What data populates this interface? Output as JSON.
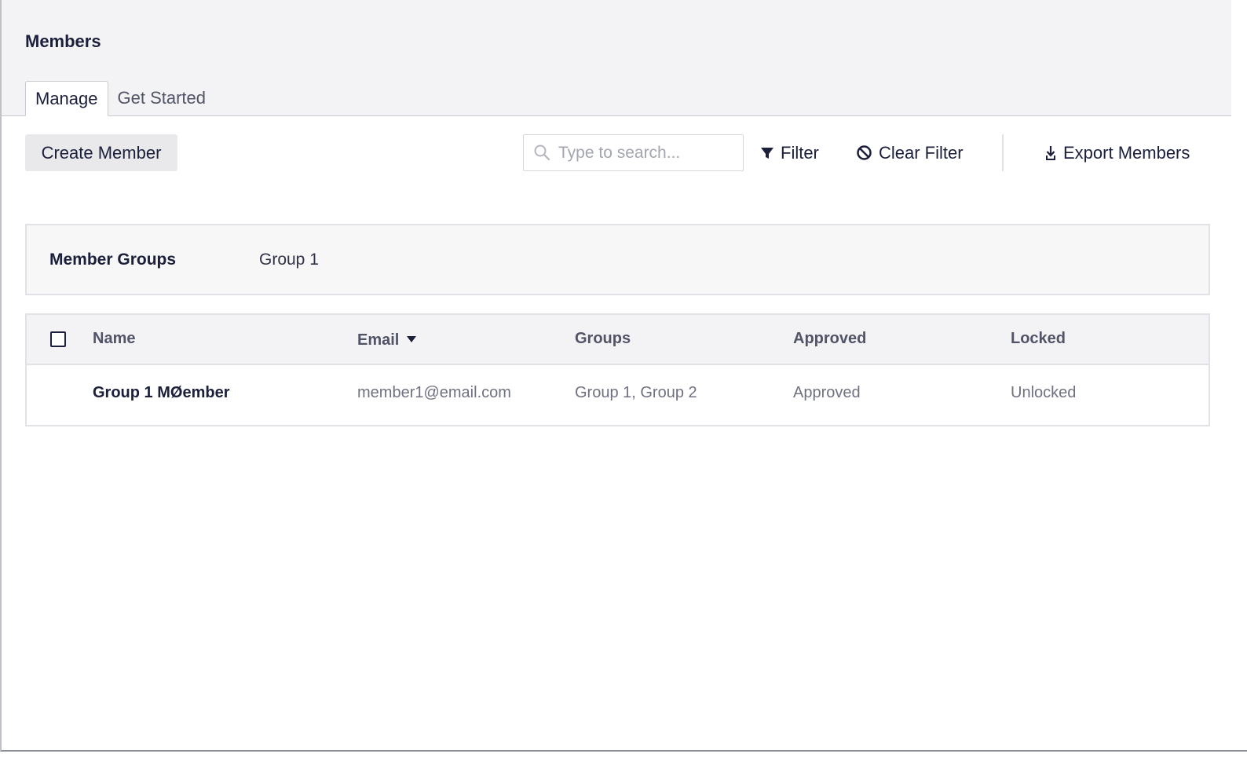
{
  "header": {
    "title": "Members",
    "tabs": [
      {
        "label": "Manage",
        "active": true
      },
      {
        "label": "Get Started",
        "active": false
      }
    ]
  },
  "toolbar": {
    "create_label": "Create Member",
    "search_placeholder": "Type to search...",
    "search_value": "",
    "filter_label": "Filter",
    "clear_filter_label": "Clear Filter",
    "export_label": "Export Members",
    "icons": {
      "search": "search-icon",
      "filter": "filter-funnel-icon",
      "clear": "ban-circle-icon",
      "export": "download-icon"
    }
  },
  "member_groups": {
    "label": "Member Groups",
    "items": [
      "Group 1"
    ]
  },
  "table": {
    "columns": [
      "Name",
      "Email",
      "Groups",
      "Approved",
      "Locked"
    ],
    "sorted_column": "Email",
    "sort_direction": "descending",
    "rows": [
      {
        "name": "Group 1 MØember",
        "email": "member1@email.com",
        "groups": "Group 1, Group 2",
        "approved": "Approved",
        "locked": "Unlocked"
      }
    ]
  },
  "colors": {
    "header_bg": "#f3f3f5",
    "text_primary": "#1b1f3a",
    "text_muted": "#6f7180",
    "button_bg": "#e9e9eb",
    "panel_bg": "#f7f7f7",
    "border": "#e2e2e6"
  }
}
